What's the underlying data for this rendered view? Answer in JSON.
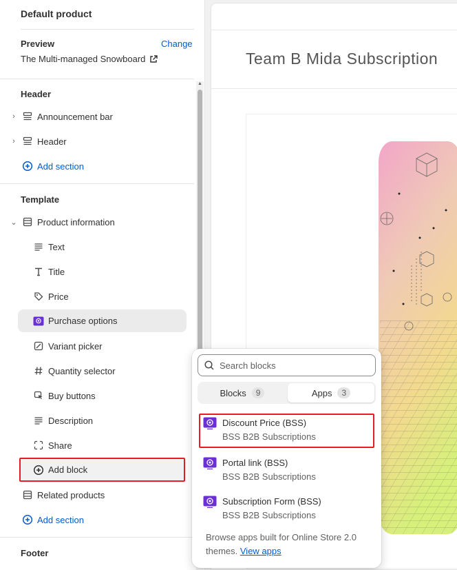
{
  "sidebar": {
    "title": "Default product",
    "preview": {
      "label": "Preview",
      "change": "Change",
      "value": "The Multi-managed Snowboard"
    },
    "header_section": {
      "title": "Header",
      "items": [
        {
          "label": "Announcement bar"
        },
        {
          "label": "Header"
        }
      ],
      "add_section": "Add section"
    },
    "template_section": {
      "title": "Template",
      "product_information": "Product information",
      "blocks": [
        {
          "label": "Text"
        },
        {
          "label": "Title"
        },
        {
          "label": "Price"
        },
        {
          "label": "Purchase options"
        },
        {
          "label": "Variant picker"
        },
        {
          "label": "Quantity selector"
        },
        {
          "label": "Buy buttons"
        },
        {
          "label": "Description"
        },
        {
          "label": "Share"
        }
      ],
      "add_block": "Add block",
      "related_products": "Related products",
      "add_section": "Add section"
    },
    "footer_section": {
      "title": "Footer"
    }
  },
  "preview": {
    "store_title": "Team B Mida Subscription"
  },
  "popover": {
    "search_placeholder": "Search blocks",
    "tabs": [
      {
        "label": "Blocks",
        "count": "9"
      },
      {
        "label": "Apps",
        "count": "3"
      }
    ],
    "apps": [
      {
        "name": "Discount Price (BSS)",
        "subtitle": "BSS B2B Subscriptions"
      },
      {
        "name": "Portal link (BSS)",
        "subtitle": "BSS B2B Subscriptions"
      },
      {
        "name": "Subscription Form (BSS)",
        "subtitle": "BSS B2B Subscriptions"
      }
    ],
    "footer_text": "Browse apps built for Online Store 2.0 themes.",
    "footer_link": "View apps"
  },
  "colors": {
    "accent": "#005bd3",
    "highlight": "#e51c23",
    "app_icon": "#6b2fd6"
  }
}
